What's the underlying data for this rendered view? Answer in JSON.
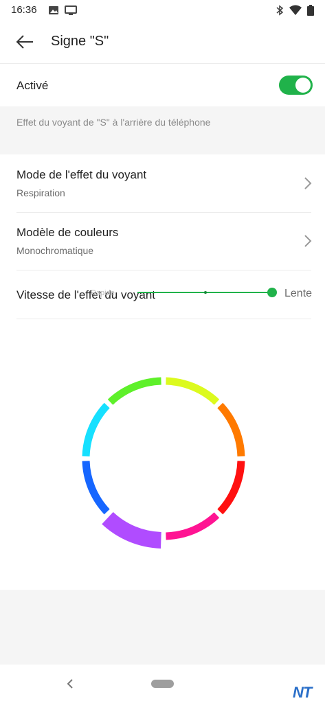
{
  "status_bar": {
    "time": "16:36",
    "left_icons": [
      "image-icon",
      "cast-screen-icon"
    ],
    "right_icons": [
      "bluetooth-icon",
      "wifi-icon",
      "battery-icon"
    ]
  },
  "header": {
    "back_icon": "arrow-left-icon",
    "title": "Signe \"S\""
  },
  "activated": {
    "label": "Activé",
    "enabled": true,
    "toggle_color": "#20b24a"
  },
  "description": "Effet du voyant de \"S\" à l'arrière du téléphone",
  "settings": [
    {
      "title": "Mode de l'effet du voyant",
      "value": "Respiration",
      "icon": "chevron-right-icon"
    },
    {
      "title": "Modèle de couleurs",
      "value": "Monochromatique",
      "icon": "chevron-right-icon"
    }
  ],
  "speed": {
    "label": "Vitesse de l'effet du voyant",
    "left_label": "Rapide",
    "right_label": "Lente",
    "position_fraction": 1.0
  },
  "color_ring": {
    "segments": [
      {
        "color": "#dcfa1e",
        "selected": false
      },
      {
        "color": "#ff7a00",
        "selected": false
      },
      {
        "color": "#ff1010",
        "selected": false
      },
      {
        "color": "#ff1493",
        "selected": false
      },
      {
        "color": "#b04cff",
        "selected": true
      },
      {
        "color": "#1666ff",
        "selected": false
      },
      {
        "color": "#16e0ff",
        "selected": false
      },
      {
        "color": "#5ef02a",
        "selected": false
      }
    ]
  },
  "nav_bar": {
    "back_icon": "nav-back-icon",
    "home_icon": "home-pill-icon"
  },
  "watermark": "NT"
}
